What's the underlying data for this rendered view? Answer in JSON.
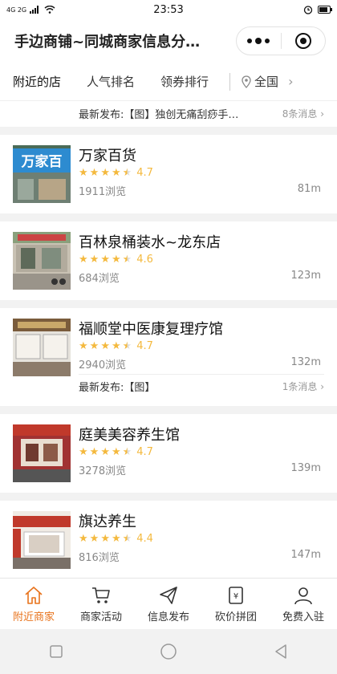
{
  "status_bar": {
    "signal_left": "4G 2G",
    "time": "23:53",
    "battery_level": 0.8
  },
  "header": {
    "title": "手边商铺~同城商家信息分…"
  },
  "tabs": [
    {
      "label": "附近的店",
      "active": true
    },
    {
      "label": "人气排名",
      "active": false
    },
    {
      "label": "领券排行",
      "active": false
    }
  ],
  "region": {
    "label": "全国",
    "icon": "location-pin-icon"
  },
  "partial_top": {
    "news_label": "最新发布:【图】独创无痛刮痧手…",
    "news_count": "8条消息"
  },
  "shops": [
    {
      "name": "万家百货",
      "rating": "4.7",
      "stars": 4.5,
      "views": "1911浏览",
      "distance": "81m",
      "img_theme": "blue-sign",
      "img_text": "万家百"
    },
    {
      "name": "百林泉桶装水~龙东店",
      "rating": "4.6",
      "stars": 4.5,
      "views": "684浏览",
      "distance": "123m",
      "img_theme": "street"
    },
    {
      "name": "福顺堂中医康复理疗馆",
      "rating": "4.7",
      "stars": 4.5,
      "views": "2940浏览",
      "distance": "132m",
      "img_theme": "white-shop",
      "news_label": "最新发布:【图】",
      "news_count": "1条消息"
    },
    {
      "name": "庭美美容养生馆",
      "rating": "4.7",
      "stars": 4.5,
      "views": "3278浏览",
      "distance": "139m",
      "img_theme": "red-shop"
    },
    {
      "name": "旗达养生",
      "rating": "4.4",
      "stars": 4.5,
      "views": "816浏览",
      "distance": "147m",
      "img_theme": "red-banner"
    }
  ],
  "bottom_nav": [
    {
      "label": "附近商家",
      "icon": "home-icon",
      "active": true
    },
    {
      "label": "商家活动",
      "icon": "cart-icon",
      "active": false
    },
    {
      "label": "信息发布",
      "icon": "paper-plane-icon",
      "active": false
    },
    {
      "label": "砍价拼团",
      "icon": "coupon-icon",
      "active": false
    },
    {
      "label": "免费入驻",
      "icon": "user-icon",
      "active": false
    }
  ],
  "colors": {
    "accent": "#e8731c",
    "star": "#f4b93e"
  }
}
